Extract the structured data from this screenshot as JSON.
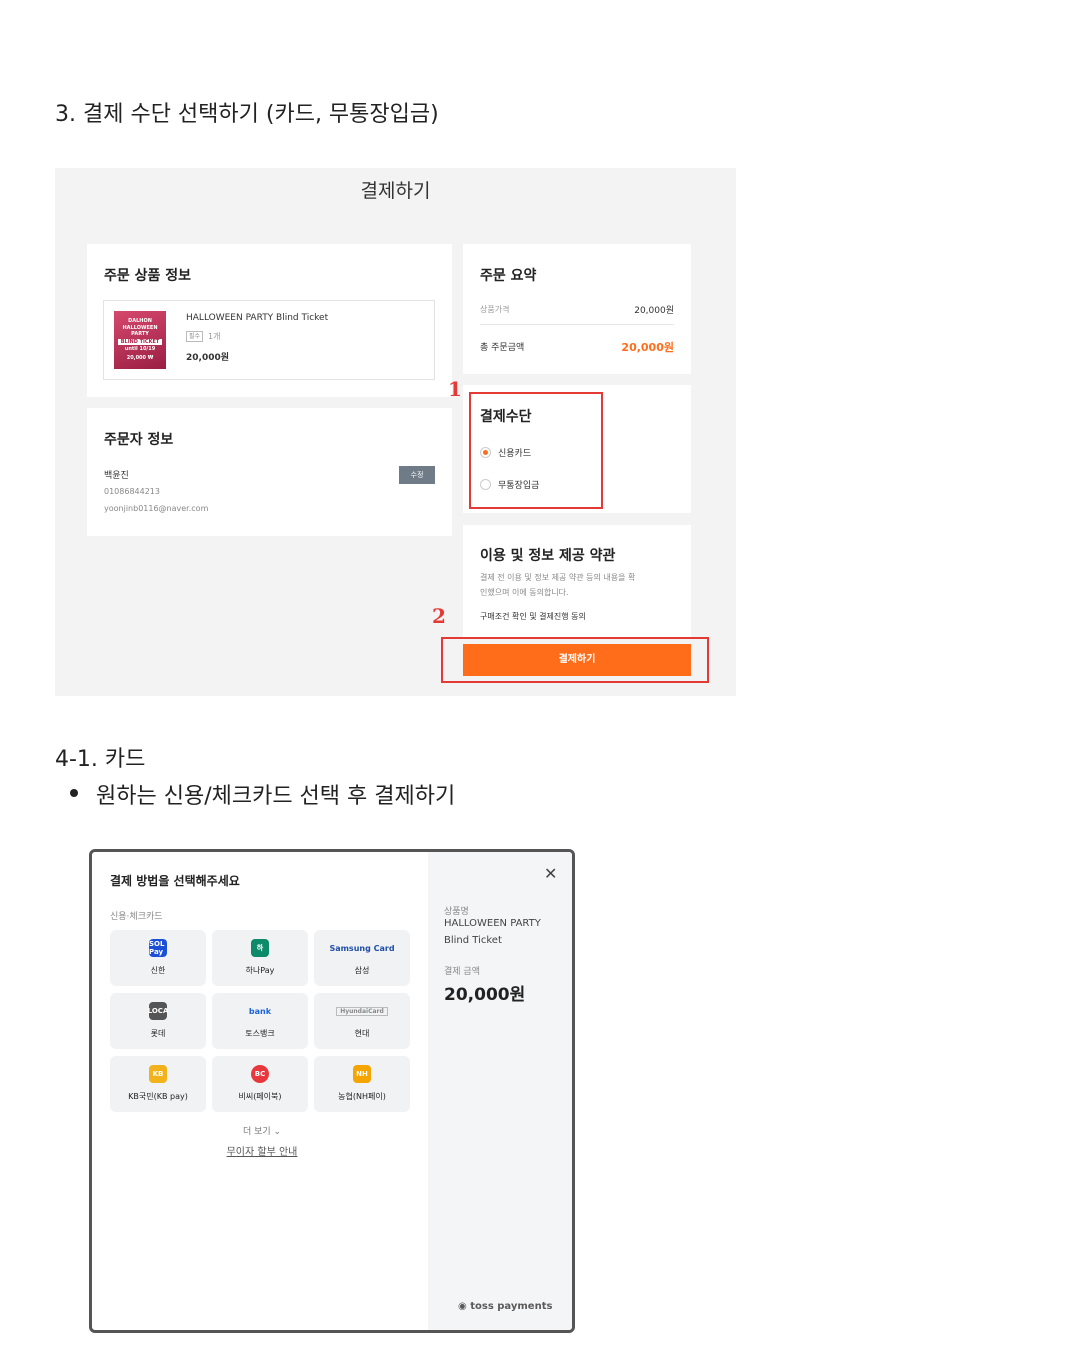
{
  "headings": {
    "section3": "3. 결제 수단 선택하기 (카드, 무통장입금)",
    "section41": "4-1. 카드",
    "bullet": "원하는 신용/체크카드 선택 후 결제하기"
  },
  "checkout": {
    "title": "결제하기",
    "order_info": {
      "title": "주문 상품 정보",
      "product_name": "HALLOWEEN PARTY Blind Ticket",
      "option_badge": "필수",
      "quantity": "1개",
      "price": "20,000원",
      "thumb_lines": [
        "DALHON",
        "HALLOWEEN PARTY",
        "BLIND TICKET",
        "until 10/19",
        "20,000 ₩"
      ]
    },
    "buyer_info": {
      "title": "주문자 정보",
      "name": "백윤진",
      "phone": "01086844213",
      "email": "yoonjinb0116@naver.com",
      "edit_label": "수정"
    },
    "summary": {
      "title": "주문 요약",
      "product_price_label": "상품가격",
      "product_price": "20,000원",
      "total_label": "총 주문금액",
      "total": "20,000원"
    },
    "payment_method": {
      "title": "결제수단",
      "options": [
        {
          "label": "신용카드",
          "selected": true
        },
        {
          "label": "무통장입금",
          "selected": false
        }
      ]
    },
    "terms": {
      "title": "이용 및 정보 제공 약관",
      "description_line1": "결제 전 이용 및 정보 제공 약관 등의 내용을 확",
      "description_line2": "인했으며 이에 동의합니다.",
      "agree_label": "구매조건 확인 및 결제진행 동의"
    },
    "pay_button": "결제하기",
    "markers": [
      "1",
      "2"
    ],
    "colors": {
      "accent": "#ff6d1b",
      "highlight": "#e53935",
      "background": "#f3f3f3"
    }
  },
  "payment_modal": {
    "title": "결제 방법을 선택해주세요",
    "section_label": "신용·체크카드",
    "cards": [
      {
        "label": "신한",
        "logo": "SOL Pay",
        "icon": "shinhan-icon",
        "color": "#1a4fd8"
      },
      {
        "label": "하나Pay",
        "logo": "하",
        "icon": "hana-icon",
        "color": "#0c8a6a"
      },
      {
        "label": "삼성",
        "logo": "Samsung Card",
        "icon": "samsung-icon",
        "color": "#1f4ea8"
      },
      {
        "label": "롯데",
        "logo": "LOCA",
        "icon": "lotte-icon",
        "color": "#555555"
      },
      {
        "label": "토스뱅크",
        "logo": "bank",
        "icon": "tossbank-icon",
        "color": "#1b64da"
      },
      {
        "label": "현대",
        "logo": "HyundaiCard",
        "icon": "hyundai-icon",
        "color": "#888888"
      },
      {
        "label": "KB국민(KB pay)",
        "logo": "KB",
        "icon": "kb-icon",
        "color": "#f2b21b"
      },
      {
        "label": "비씨(페이북)",
        "logo": "BC",
        "icon": "bc-icon",
        "color": "#e8383d"
      },
      {
        "label": "농협(NH페이)",
        "logo": "NH",
        "icon": "nh-icon",
        "color": "#f5a400"
      }
    ],
    "more_label": "더 보기",
    "installment_label": "무이자 할부 안내",
    "side": {
      "product_label": "상품명",
      "product_name_line1": "HALLOWEEN PARTY",
      "product_name_line2": "Blind Ticket",
      "amount_label": "결제 금액",
      "amount": "20,000원",
      "brand": "toss payments"
    }
  }
}
